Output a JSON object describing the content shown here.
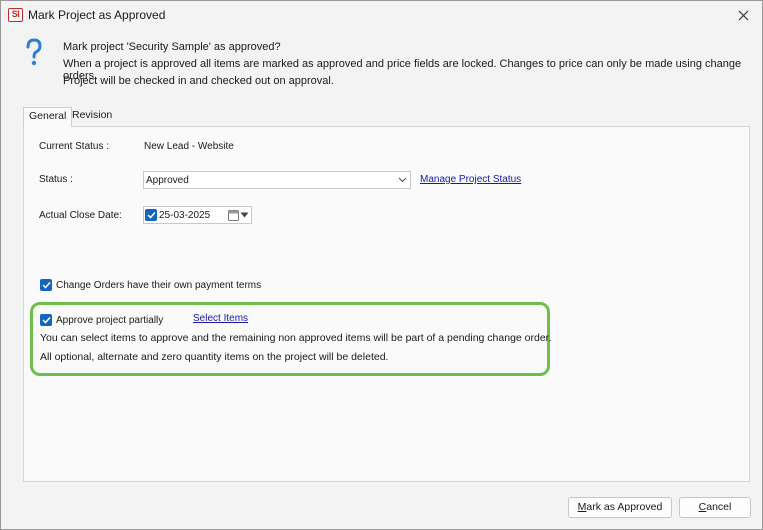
{
  "window": {
    "app_logo": "SI",
    "title": "Mark Project as Approved"
  },
  "message": {
    "icon": "question-mark-icon",
    "line1": "Mark project 'Security Sample' as approved?",
    "line2": "When a project is approved all items are marked as approved and price fields are locked. Changes to price can only be made using change orders.",
    "line3": "Project will be checked in and checked out on approval."
  },
  "tabs": [
    {
      "label": "General",
      "active": true
    },
    {
      "label": "Revision",
      "active": false
    }
  ],
  "form": {
    "current_status_label": "Current Status :",
    "current_status_value": "New Lead - Website",
    "status_label": "Status :",
    "status_value": "Approved",
    "manage_status_link": "Manage Project Status",
    "close_date_label": "Actual Close Date:",
    "close_date_value": "25-03-2025",
    "close_date_checked": true,
    "change_orders_label": "Change Orders have their own payment terms",
    "change_orders_checked": true,
    "approve_partially_label": "Approve project partially",
    "approve_partially_checked": true,
    "select_items_link": "Select Items",
    "partial_note_1": "You can select items to approve and the remaining non approved items will be part of a pending change order.",
    "partial_note_2": "All optional, alternate and zero quantity items on the project will be deleted."
  },
  "buttons": {
    "approve_prefix": "M",
    "approve_rest": "ark as Approved",
    "cancel_prefix": "C",
    "cancel_rest": "ancel"
  },
  "colors": {
    "accent": "#1565c0",
    "highlight": "#6cc04a",
    "link": "#1a1aa6",
    "logo": "#c62828"
  }
}
